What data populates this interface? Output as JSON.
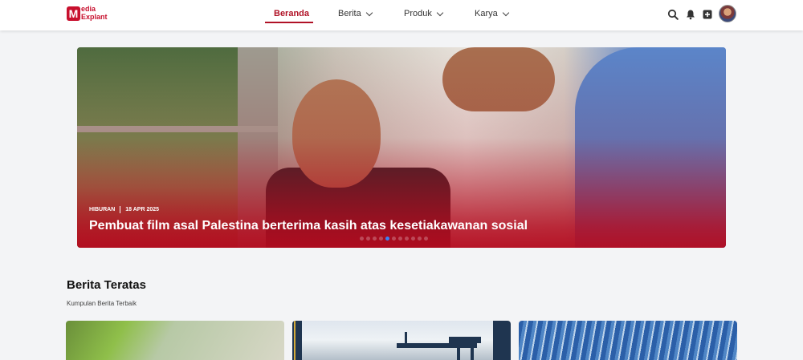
{
  "brand": {
    "logo_letter": "M",
    "logo_line1": "edia",
    "logo_line2": "Explant",
    "color": "#c8102e"
  },
  "nav": {
    "items": [
      {
        "label": "Beranda",
        "active": true
      },
      {
        "label": "Berita",
        "dropdown": true
      },
      {
        "label": "Produk",
        "dropdown": true
      },
      {
        "label": "Karya",
        "dropdown": true
      }
    ]
  },
  "header_icons": [
    "search-icon",
    "bell-icon",
    "plus-square-icon",
    "avatar"
  ],
  "hero": {
    "category": "HIBURAN",
    "date": "18 APR 2025",
    "title": "Pembuat film asal Palestina berterima kasih atas kesetiakawanan sosial",
    "active_slide": 4,
    "slide_count": 11
  },
  "section": {
    "title": "Berita Teratas",
    "subtitle": "Kumpulan Berita Terbaik"
  }
}
